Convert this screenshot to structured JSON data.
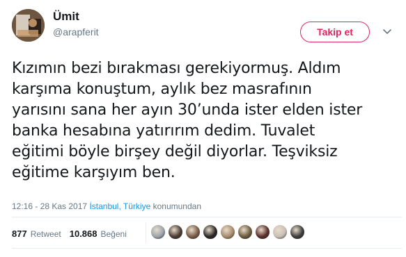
{
  "user": {
    "name": "Ümit",
    "handle": "@arapferit"
  },
  "follow_button": {
    "label": "Takip et"
  },
  "tweet": {
    "lines": [
      "Kızımın bezi bırakması gerekiyormuş. Aldım",
      "karşıma konuştum, aylık bez masrafının",
      "yarısını sana her ayın 30’unda ister elden ister",
      "banka hesabına yatırırım dedim. Tuvalet",
      "eğitimi böyle birşey değil diyorlar. Teşviksiz",
      "eğitime karşıyım ben."
    ]
  },
  "meta": {
    "time": "12:16 - 28 Kas 2017",
    "place": "İstanbul, Türkiye",
    "suffix": " konumundan"
  },
  "stats": {
    "retweet_count": "877",
    "retweet_label": "Retweet",
    "like_count": "10.868",
    "like_label": "Beğeni"
  },
  "likers": [
    {
      "icon": "avatar-gray",
      "color": "#9aa4ab"
    },
    {
      "icon": "avatar-dark",
      "color": "#4a3b33"
    },
    {
      "icon": "avatar-brown",
      "color": "#7a5a44"
    },
    {
      "icon": "avatar-black",
      "color": "#2a2624"
    },
    {
      "icon": "avatar-tan",
      "color": "#a88a6c"
    },
    {
      "icon": "avatar-olive",
      "color": "#6b5a3c"
    },
    {
      "icon": "avatar-maroon",
      "color": "#5a2e2a"
    },
    {
      "icon": "avatar-light",
      "color": "#c9bfb4"
    },
    {
      "icon": "avatar-charcoal",
      "color": "#3c3c3c"
    }
  ],
  "colors": {
    "accent": "#e0245e",
    "link": "#1b95e0",
    "muted": "#657786",
    "text": "#14171a"
  }
}
